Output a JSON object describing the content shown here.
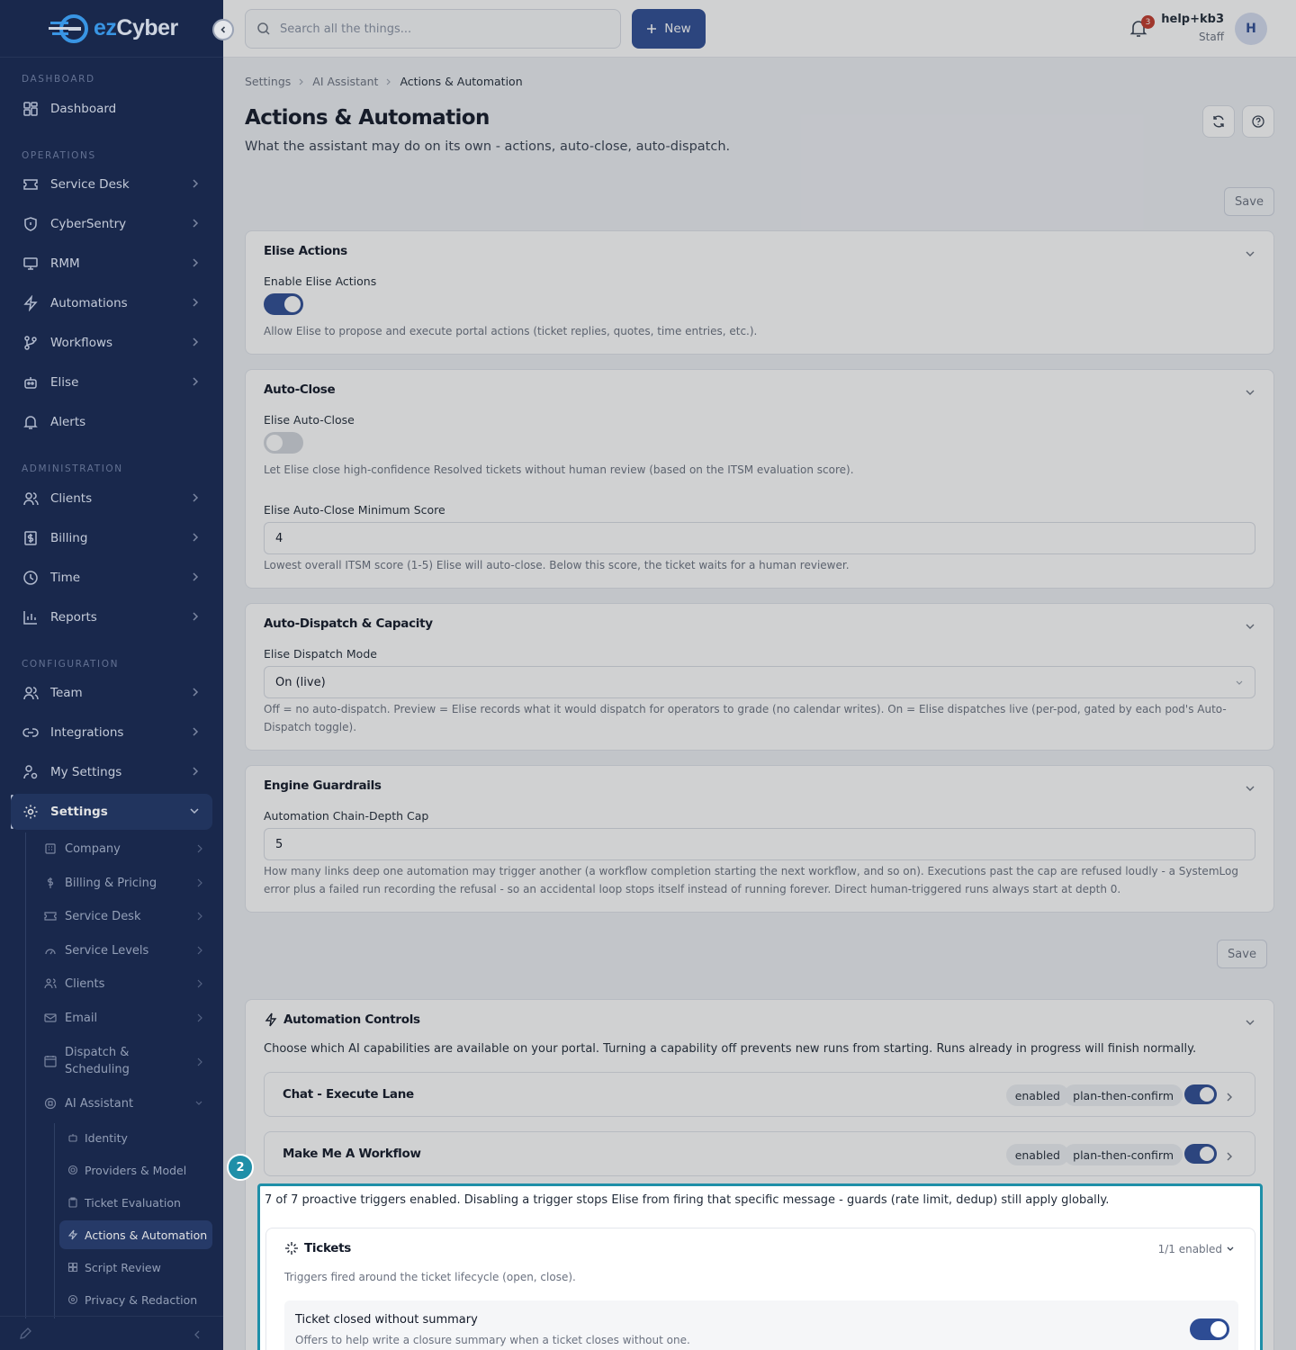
{
  "brand": {
    "name_prefix": "ez",
    "name_suffix": "Cyber"
  },
  "sidebar": {
    "sections": {
      "dashboard": "DASHBOARD",
      "operations": "OPERATIONS",
      "administration": "ADMINISTRATION",
      "configuration": "CONFIGURATION"
    },
    "items": {
      "dashboard": "Dashboard",
      "service_desk": "Service Desk",
      "cybersentry": "CyberSentry",
      "rmm": "RMM",
      "automations": "Automations",
      "workflows": "Workflows",
      "elise": "Elise",
      "alerts": "Alerts",
      "clients": "Clients",
      "billing": "Billing",
      "time": "Time",
      "reports": "Reports",
      "team": "Team",
      "integrations": "Integrations",
      "my_settings": "My Settings",
      "settings": "Settings"
    },
    "settings_sub": {
      "company": "Company",
      "billing_pricing": "Billing & Pricing",
      "service_desk": "Service Desk",
      "service_levels": "Service Levels",
      "clients": "Clients",
      "email": "Email",
      "dispatch_line1": "Dispatch &",
      "dispatch_line2": "Scheduling",
      "ai_assistant": "AI Assistant"
    },
    "ai_sub": {
      "identity": "Identity",
      "providers_model": "Providers & Model",
      "ticket_evaluation": "Ticket Evaluation",
      "actions_automation": "Actions & Automation",
      "script_review": "Script Review",
      "privacy_redaction": "Privacy & Redaction"
    }
  },
  "topbar": {
    "search_placeholder": "Search all the things...",
    "new_label": "New",
    "notification_count": "3",
    "user_name": "help+kb3",
    "user_role": "Staff",
    "avatar_initial": "H"
  },
  "breadcrumb": [
    "Settings",
    "AI Assistant",
    "Actions & Automation"
  ],
  "page": {
    "title": "Actions & Automation",
    "subtitle": "What the assistant may do on its own - actions, auto-close, auto-dispatch.",
    "save_label": "Save"
  },
  "cards": {
    "elise_actions": {
      "title": "Elise Actions",
      "label": "Enable Elise Actions",
      "enabled": true,
      "help": "Allow Elise to propose and execute portal actions (ticket replies, quotes, time entries, etc.)."
    },
    "auto_close": {
      "title": "Auto-Close",
      "toggle_label": "Elise Auto-Close",
      "enabled": false,
      "toggle_help": "Let Elise close high-confidence Resolved tickets without human review (based on the ITSM evaluation score).",
      "score_label": "Elise Auto-Close Minimum Score",
      "score_value": "4",
      "score_help": "Lowest overall ITSM score (1-5) Elise will auto-close. Below this score, the ticket waits for a human reviewer."
    },
    "auto_dispatch": {
      "title": "Auto-Dispatch & Capacity",
      "label": "Elise Dispatch Mode",
      "value": "On (live)",
      "help": "Off = no auto-dispatch. Preview = Elise records what it would dispatch for operators to grade (no calendar writes). On = Elise dispatches live (per-pod, gated by each pod's Auto-Dispatch toggle)."
    },
    "engine_guardrails": {
      "title": "Engine Guardrails",
      "label": "Automation Chain-Depth Cap",
      "value": "5",
      "help": "How many links deep one automation may trigger another (a workflow completion starting the next workflow, and so on). Executions past the cap are refused loudly - a SystemLog error plus a failed run recording the refusal - so an accidental loop stops itself instead of running forever. Direct human-triggered runs always start at depth 0."
    },
    "automation_controls": {
      "title": "Automation Controls",
      "description": "Choose which AI capabilities are available on your portal. Turning a capability off prevents new runs from starting. Runs already in progress will finish normally.",
      "lanes": [
        {
          "name": "Chat - Execute Lane",
          "status": "enabled",
          "mode": "plan-then-confirm",
          "enabled": true
        },
        {
          "name": "Make Me A Workflow",
          "status": "enabled",
          "mode": "plan-then-confirm",
          "enabled": true
        }
      ]
    }
  },
  "callout": {
    "step": "2",
    "summary": "7 of 7 proactive triggers enabled. Disabling a trigger stops Elise from firing that specific message - guards (rate limit, dedup) still apply globally.",
    "group": {
      "title": "Tickets",
      "count": "1/1 enabled",
      "description": "Triggers fired around the ticket lifecycle (open, close).",
      "trigger": {
        "name": "Ticket closed without summary",
        "description": "Offers to help write a closure summary when a ticket closes without one.",
        "enabled": true
      }
    }
  },
  "colors": {
    "sidebar": "#1b2b52",
    "primary": "#2d4c94",
    "highlight": "#1f8fa8"
  }
}
